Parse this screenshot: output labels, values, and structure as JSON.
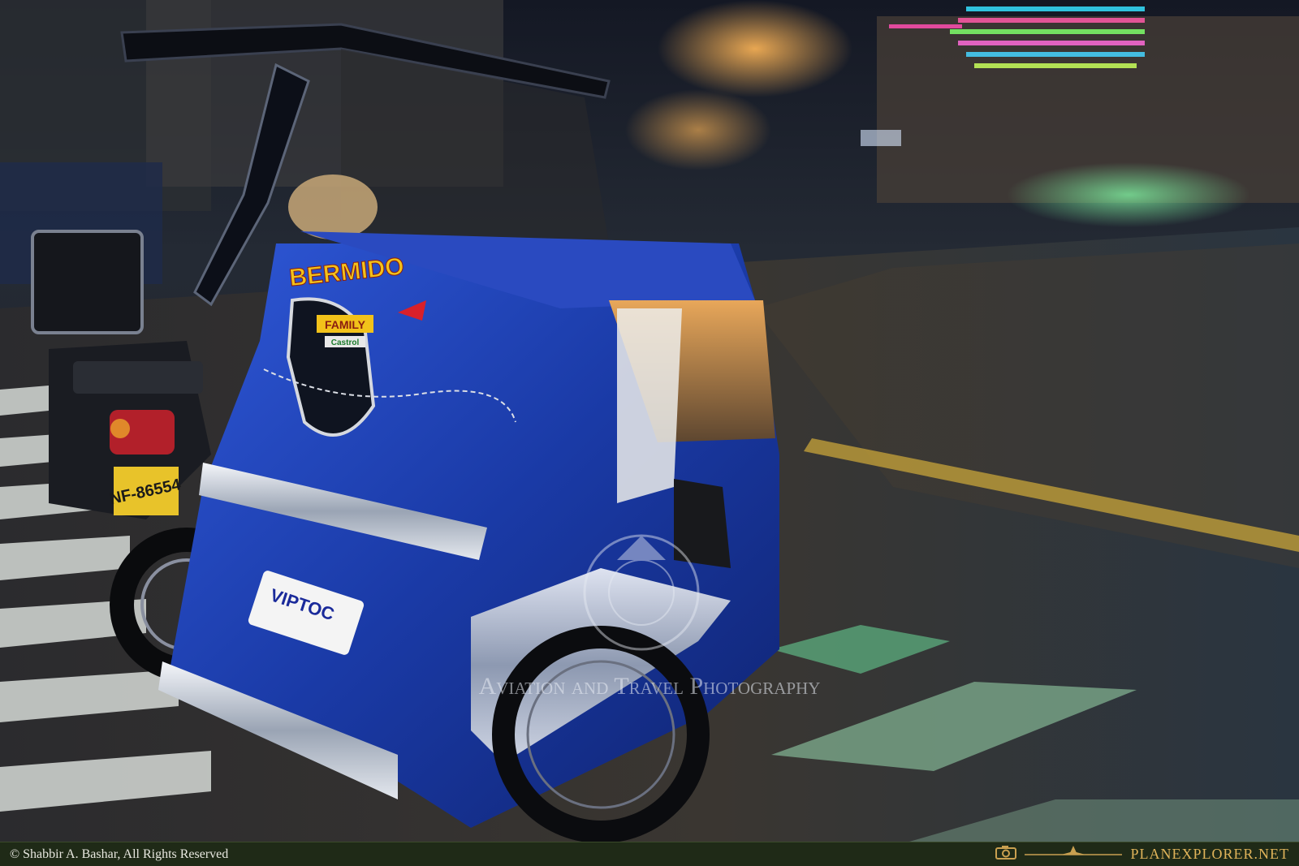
{
  "photo": {
    "scene": "Blue tricycle on a wet street at night",
    "colors": {
      "sky": "#1a1f2a",
      "road": "#2a2f38",
      "sidecar_blue": "#1e3aa8",
      "sign_yellow": "#f2c21a",
      "crosswalk": "#d8dcd8"
    }
  },
  "sidecar": {
    "name_label": "BERMIDO",
    "family_label": "FAMILY",
    "castrol_label": "Castrol",
    "plate": "NF-86554",
    "route_label": "VIPTOC"
  },
  "watermark": {
    "text": "Aviation and Travel Photography"
  },
  "footer": {
    "copyright": "© Shabbir A. Bashar, All Rights Reserved",
    "brand_prefix": "PLANE",
    "brand_middle": "X",
    "brand_suffix": "PLORER",
    "brand_tld": ".NET"
  }
}
